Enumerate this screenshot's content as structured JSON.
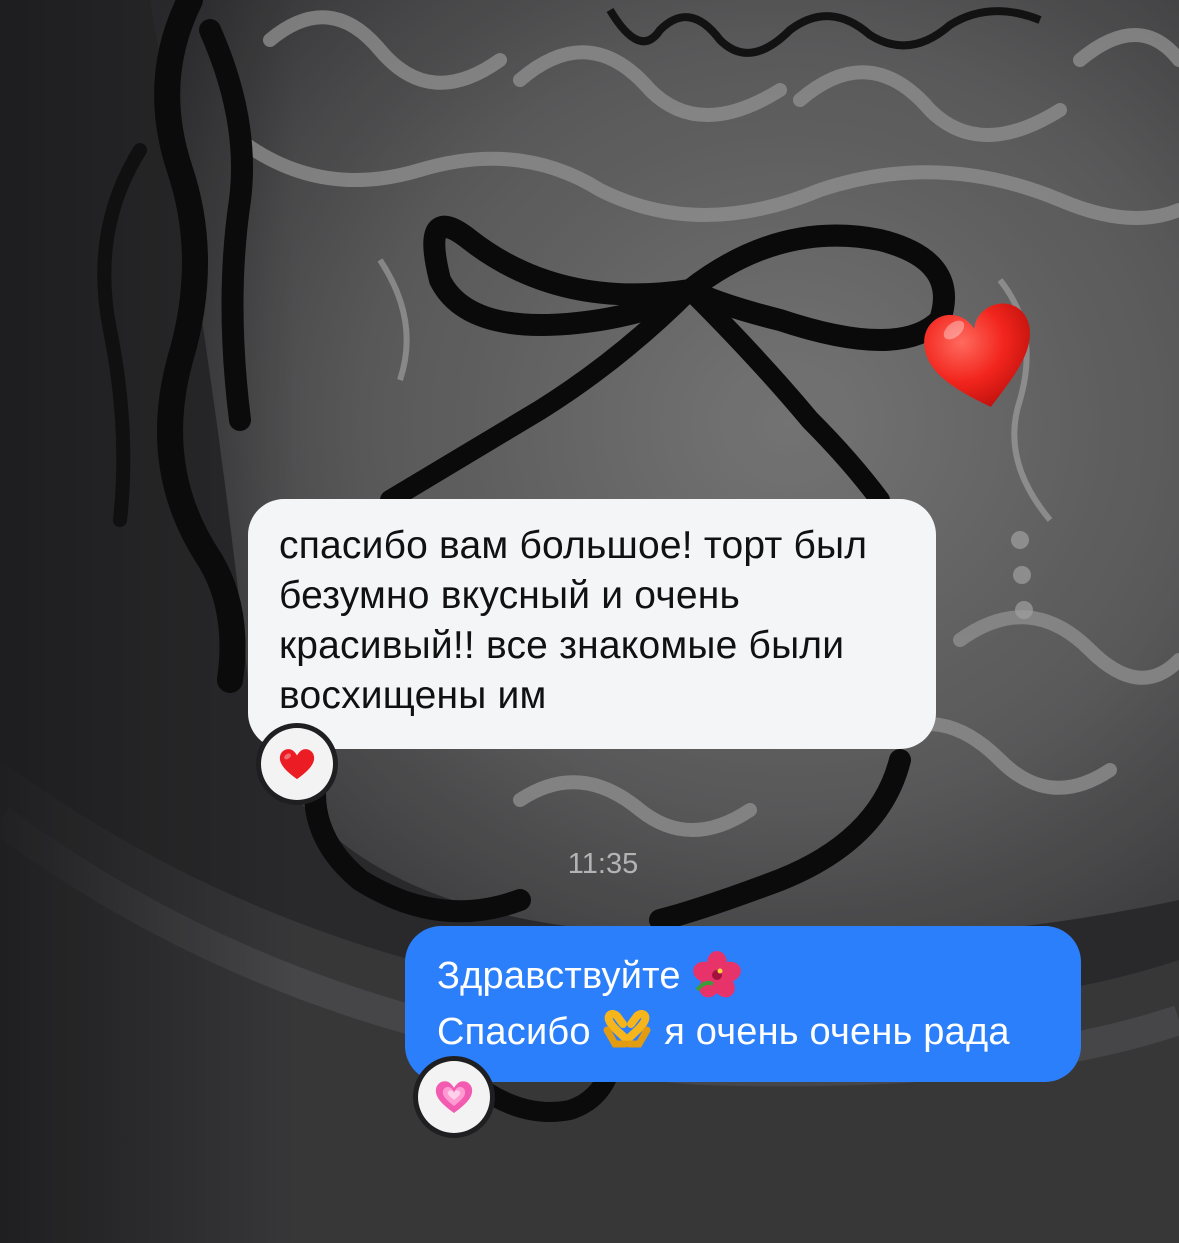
{
  "conversation": {
    "incoming": {
      "lines": [
        "спасибо вам большое! торт был",
        "безумно вкусный и очень",
        "красивый!! все знакомые были",
        "восхищены им"
      ],
      "reaction": "red-heart-icon"
    },
    "timestamp": "11:35",
    "outgoing": {
      "line1_text": "Здравствуйте",
      "line1_emoji": "hibiscus-icon",
      "line2_text_before": "Спасибо",
      "line2_emoji": "heart-hands-icon",
      "line2_text_after": "я очень очень рада",
      "reaction": "pink-heart-icon"
    },
    "sticker": "red-heart-sticker-icon"
  },
  "colors": {
    "outgoing_bubble": "#2b7ffb",
    "incoming_bubble": "#f4f5f7",
    "timestamp": "#b3b3b6"
  }
}
